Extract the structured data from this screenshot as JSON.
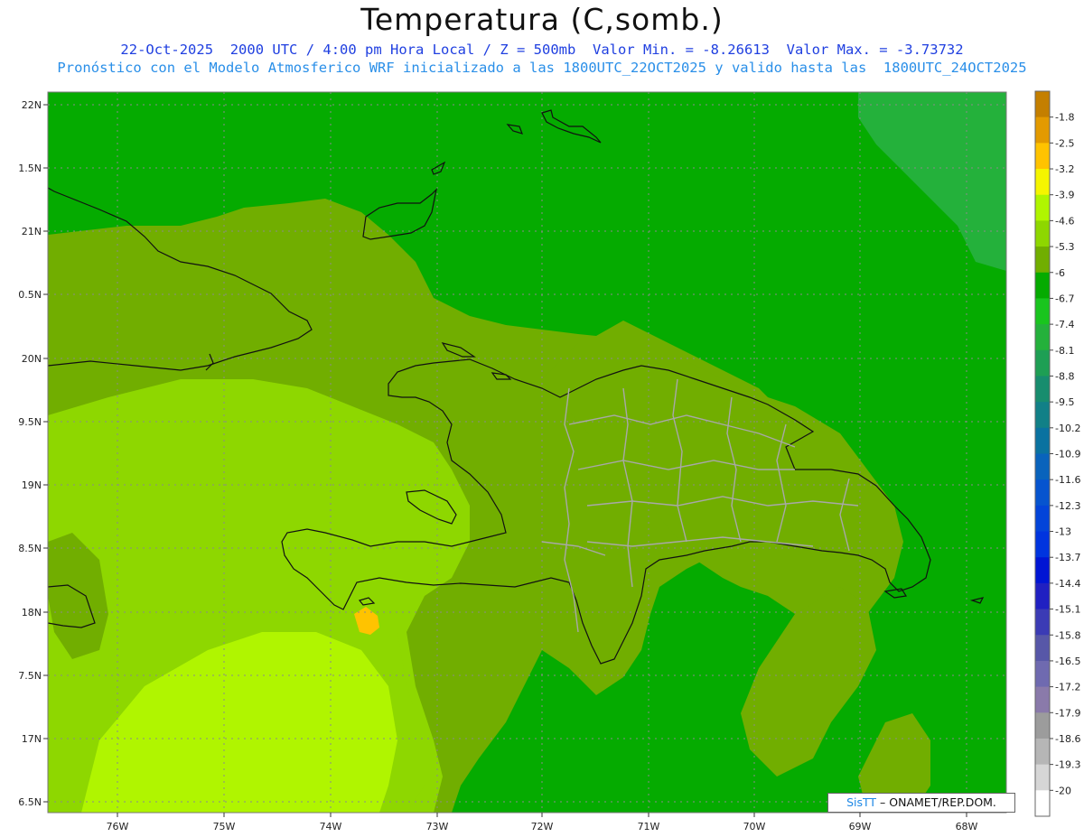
{
  "header": {
    "title": "Temperatura (C,somb.)",
    "line1": "22-Oct-2025  2000 UTC / 4:00 pm Hora Local / Z = 500mb  Valor Min. = -8.26613  Valor Max. = -3.73732",
    "line2": "Pronóstico con el Modelo Atmosferico WRF inicializado a las 1800UTC_22OCT2025 y valido hasta las  1800UTC_24OCT2025"
  },
  "axes": {
    "lat_labels": [
      "22N",
      "1.5N",
      "21N",
      "0.5N",
      "20N",
      "9.5N",
      "19N",
      "8.5N",
      "18N",
      "7.5N",
      "17N",
      "6.5N"
    ],
    "lon_labels": [
      "76W",
      "75W",
      "74W",
      "73W",
      "72W",
      "71W",
      "70W",
      "69W",
      "68W"
    ]
  },
  "colorbar": {
    "labels": [
      "-1.8",
      "-2.5",
      "-3.2",
      "-3.9",
      "-4.6",
      "-5.3",
      "-6",
      "-6.7",
      "-7.4",
      "-8.1",
      "-8.8",
      "-9.5",
      "-10.2",
      "-10.9",
      "-11.6",
      "-12.3",
      "-13",
      "-13.7",
      "-14.4",
      "-15.1",
      "-15.8",
      "-16.5",
      "-17.2",
      "-17.9",
      "-18.6",
      "-19.3",
      "-20"
    ],
    "colors": [
      "#c47f00",
      "#e39a00",
      "#ffc300",
      "#f5f500",
      "#b0f500",
      "#8ed700",
      "#71ae00",
      "#05ab00",
      "#19c51e",
      "#24b13b",
      "#1e9f54",
      "#178d6e",
      "#118087",
      "#0a72a0",
      "#0963bc",
      "#0654cf",
      "#0344d9",
      "#0034df",
      "#0015d4",
      "#2020c2",
      "#3b3bb5",
      "#5757a8",
      "#6f6ab0",
      "#8a7aaa",
      "#9c9c9c",
      "#b6b6b6",
      "#d6d6d6"
    ],
    "bottom_color": "#ffffff"
  },
  "field_colors": {
    "c_37": "#b0f500",
    "c_46": "#8ed700",
    "c_53": "#71ae00",
    "c_60": "#05ab00",
    "c_67": "#19c51e",
    "c_74": "#24b13b",
    "c_32": "#ffc300"
  },
  "credit": {
    "brand": "SisTT",
    "text": " ONAMET/REP.DOM."
  }
}
